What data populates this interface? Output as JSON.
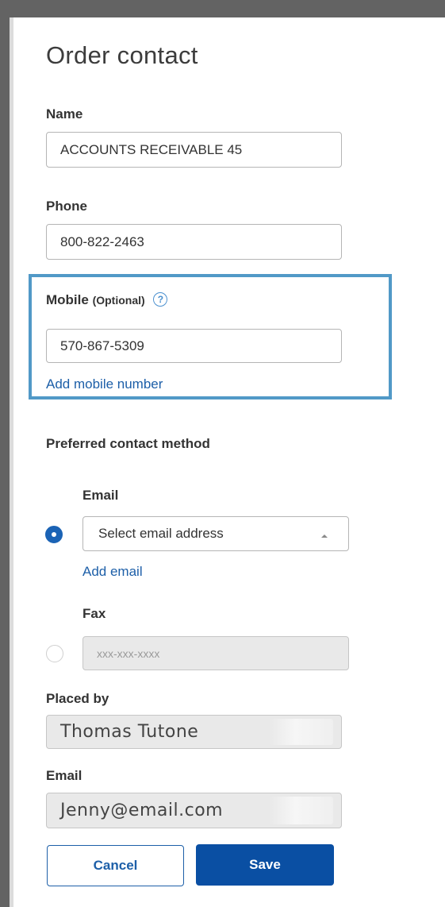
{
  "form": {
    "title": "Order contact",
    "name": {
      "label": "Name",
      "value": "ACCOUNTS RECEIVABLE 45"
    },
    "phone": {
      "label": "Phone",
      "value": "800-822-2463"
    },
    "mobile": {
      "label": "Mobile",
      "optional_label": "(Optional)",
      "help_glyph": "?",
      "value": "570-867-5309",
      "add_link": "Add mobile number"
    },
    "preferred": {
      "label": "Preferred contact method",
      "email": {
        "label": "Email",
        "selected": true,
        "select_value": "Select email address",
        "add_link": "Add email"
      },
      "fax": {
        "label": "Fax",
        "selected": false,
        "placeholder": "xxx-xxx-xxxx"
      }
    },
    "placed_by": {
      "label": "Placed by",
      "value": "Thomas Tutone"
    },
    "email": {
      "label": "Email",
      "value": "Jenny@email.com"
    },
    "buttons": {
      "cancel": "Cancel",
      "save": "Save"
    }
  },
  "colors": {
    "primary": "#0a4fa3",
    "link": "#1d5fa8",
    "highlight": "#5199c7",
    "frame": "#636363"
  }
}
